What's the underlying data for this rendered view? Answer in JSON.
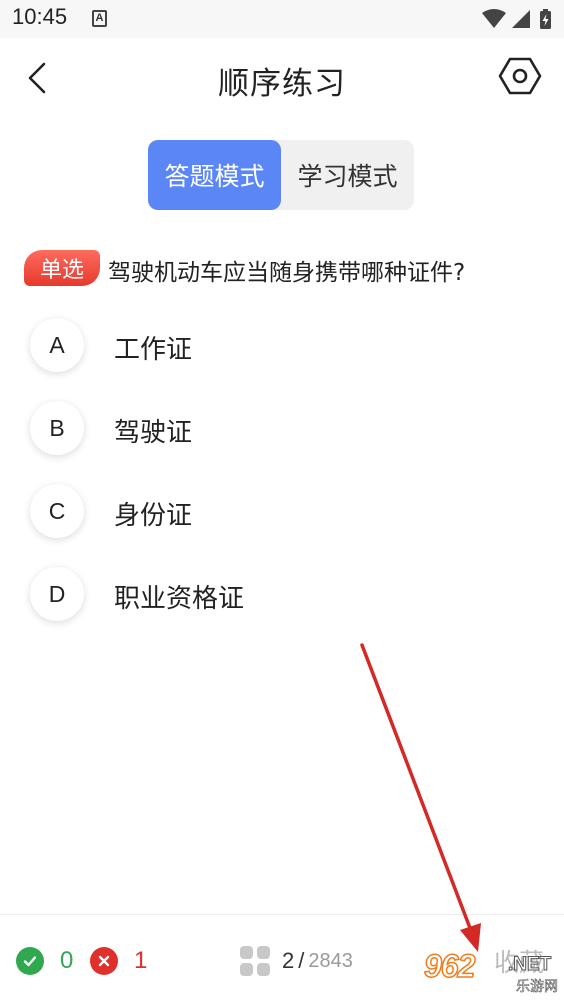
{
  "status_bar": {
    "time": "10:45",
    "notification_letter": "A",
    "icons": [
      "wifi-icon",
      "signal-icon",
      "battery-charging-icon"
    ]
  },
  "header": {
    "title": "顺序练习",
    "back_icon": "chevron-left-icon",
    "settings_icon": "hexagon-settings-icon"
  },
  "mode_switch": {
    "tabs": [
      {
        "label": "答题模式",
        "active": true
      },
      {
        "label": "学习模式",
        "active": false
      }
    ]
  },
  "question": {
    "type_badge": "单选",
    "text": "驾驶机动车应当随身携带哪种证件?",
    "options": [
      {
        "letter": "A",
        "text": "工作证"
      },
      {
        "letter": "B",
        "text": "驾驶证"
      },
      {
        "letter": "C",
        "text": "身份证"
      },
      {
        "letter": "D",
        "text": "职业资格证"
      }
    ]
  },
  "bottom_bar": {
    "correct_count": "0",
    "wrong_count": "1",
    "progress_current": "2",
    "progress_separator": "/",
    "progress_total": "2843",
    "collect_label": "收藏"
  },
  "watermark": {
    "logo": "962",
    "suffix": ".NET",
    "subtitle": "乐游网"
  },
  "colors": {
    "accent": "#5b86f5",
    "badge_red": "#e53a2d",
    "correct_green": "#2fa84f",
    "wrong_red": "#e0302c",
    "arrow_red": "#d42a25"
  }
}
